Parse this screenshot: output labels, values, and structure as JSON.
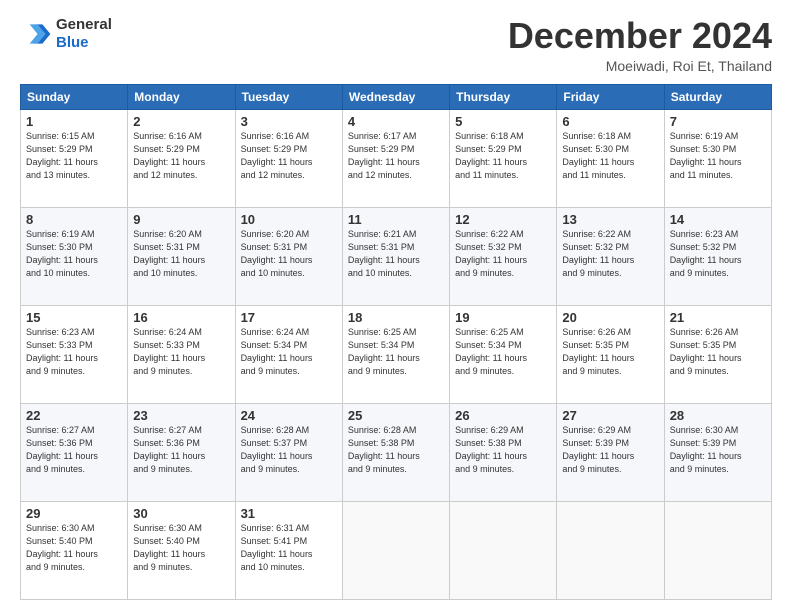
{
  "logo": {
    "general": "General",
    "blue": "Blue"
  },
  "header": {
    "title": "December 2024",
    "location": "Moeiwadi, Roi Et, Thailand"
  },
  "days_of_week": [
    "Sunday",
    "Monday",
    "Tuesday",
    "Wednesday",
    "Thursday",
    "Friday",
    "Saturday"
  ],
  "weeks": [
    [
      {
        "day": "1",
        "info": "Sunrise: 6:15 AM\nSunset: 5:29 PM\nDaylight: 11 hours\nand 13 minutes."
      },
      {
        "day": "2",
        "info": "Sunrise: 6:16 AM\nSunset: 5:29 PM\nDaylight: 11 hours\nand 12 minutes."
      },
      {
        "day": "3",
        "info": "Sunrise: 6:16 AM\nSunset: 5:29 PM\nDaylight: 11 hours\nand 12 minutes."
      },
      {
        "day": "4",
        "info": "Sunrise: 6:17 AM\nSunset: 5:29 PM\nDaylight: 11 hours\nand 12 minutes."
      },
      {
        "day": "5",
        "info": "Sunrise: 6:18 AM\nSunset: 5:29 PM\nDaylight: 11 hours\nand 11 minutes."
      },
      {
        "day": "6",
        "info": "Sunrise: 6:18 AM\nSunset: 5:30 PM\nDaylight: 11 hours\nand 11 minutes."
      },
      {
        "day": "7",
        "info": "Sunrise: 6:19 AM\nSunset: 5:30 PM\nDaylight: 11 hours\nand 11 minutes."
      }
    ],
    [
      {
        "day": "8",
        "info": "Sunrise: 6:19 AM\nSunset: 5:30 PM\nDaylight: 11 hours\nand 10 minutes."
      },
      {
        "day": "9",
        "info": "Sunrise: 6:20 AM\nSunset: 5:31 PM\nDaylight: 11 hours\nand 10 minutes."
      },
      {
        "day": "10",
        "info": "Sunrise: 6:20 AM\nSunset: 5:31 PM\nDaylight: 11 hours\nand 10 minutes."
      },
      {
        "day": "11",
        "info": "Sunrise: 6:21 AM\nSunset: 5:31 PM\nDaylight: 11 hours\nand 10 minutes."
      },
      {
        "day": "12",
        "info": "Sunrise: 6:22 AM\nSunset: 5:32 PM\nDaylight: 11 hours\nand 9 minutes."
      },
      {
        "day": "13",
        "info": "Sunrise: 6:22 AM\nSunset: 5:32 PM\nDaylight: 11 hours\nand 9 minutes."
      },
      {
        "day": "14",
        "info": "Sunrise: 6:23 AM\nSunset: 5:32 PM\nDaylight: 11 hours\nand 9 minutes."
      }
    ],
    [
      {
        "day": "15",
        "info": "Sunrise: 6:23 AM\nSunset: 5:33 PM\nDaylight: 11 hours\nand 9 minutes."
      },
      {
        "day": "16",
        "info": "Sunrise: 6:24 AM\nSunset: 5:33 PM\nDaylight: 11 hours\nand 9 minutes."
      },
      {
        "day": "17",
        "info": "Sunrise: 6:24 AM\nSunset: 5:34 PM\nDaylight: 11 hours\nand 9 minutes."
      },
      {
        "day": "18",
        "info": "Sunrise: 6:25 AM\nSunset: 5:34 PM\nDaylight: 11 hours\nand 9 minutes."
      },
      {
        "day": "19",
        "info": "Sunrise: 6:25 AM\nSunset: 5:34 PM\nDaylight: 11 hours\nand 9 minutes."
      },
      {
        "day": "20",
        "info": "Sunrise: 6:26 AM\nSunset: 5:35 PM\nDaylight: 11 hours\nand 9 minutes."
      },
      {
        "day": "21",
        "info": "Sunrise: 6:26 AM\nSunset: 5:35 PM\nDaylight: 11 hours\nand 9 minutes."
      }
    ],
    [
      {
        "day": "22",
        "info": "Sunrise: 6:27 AM\nSunset: 5:36 PM\nDaylight: 11 hours\nand 9 minutes."
      },
      {
        "day": "23",
        "info": "Sunrise: 6:27 AM\nSunset: 5:36 PM\nDaylight: 11 hours\nand 9 minutes."
      },
      {
        "day": "24",
        "info": "Sunrise: 6:28 AM\nSunset: 5:37 PM\nDaylight: 11 hours\nand 9 minutes."
      },
      {
        "day": "25",
        "info": "Sunrise: 6:28 AM\nSunset: 5:38 PM\nDaylight: 11 hours\nand 9 minutes."
      },
      {
        "day": "26",
        "info": "Sunrise: 6:29 AM\nSunset: 5:38 PM\nDaylight: 11 hours\nand 9 minutes."
      },
      {
        "day": "27",
        "info": "Sunrise: 6:29 AM\nSunset: 5:39 PM\nDaylight: 11 hours\nand 9 minutes."
      },
      {
        "day": "28",
        "info": "Sunrise: 6:30 AM\nSunset: 5:39 PM\nDaylight: 11 hours\nand 9 minutes."
      }
    ],
    [
      {
        "day": "29",
        "info": "Sunrise: 6:30 AM\nSunset: 5:40 PM\nDaylight: 11 hours\nand 9 minutes."
      },
      {
        "day": "30",
        "info": "Sunrise: 6:30 AM\nSunset: 5:40 PM\nDaylight: 11 hours\nand 9 minutes."
      },
      {
        "day": "31",
        "info": "Sunrise: 6:31 AM\nSunset: 5:41 PM\nDaylight: 11 hours\nand 10 minutes."
      },
      {
        "day": "",
        "info": ""
      },
      {
        "day": "",
        "info": ""
      },
      {
        "day": "",
        "info": ""
      },
      {
        "day": "",
        "info": ""
      }
    ]
  ]
}
